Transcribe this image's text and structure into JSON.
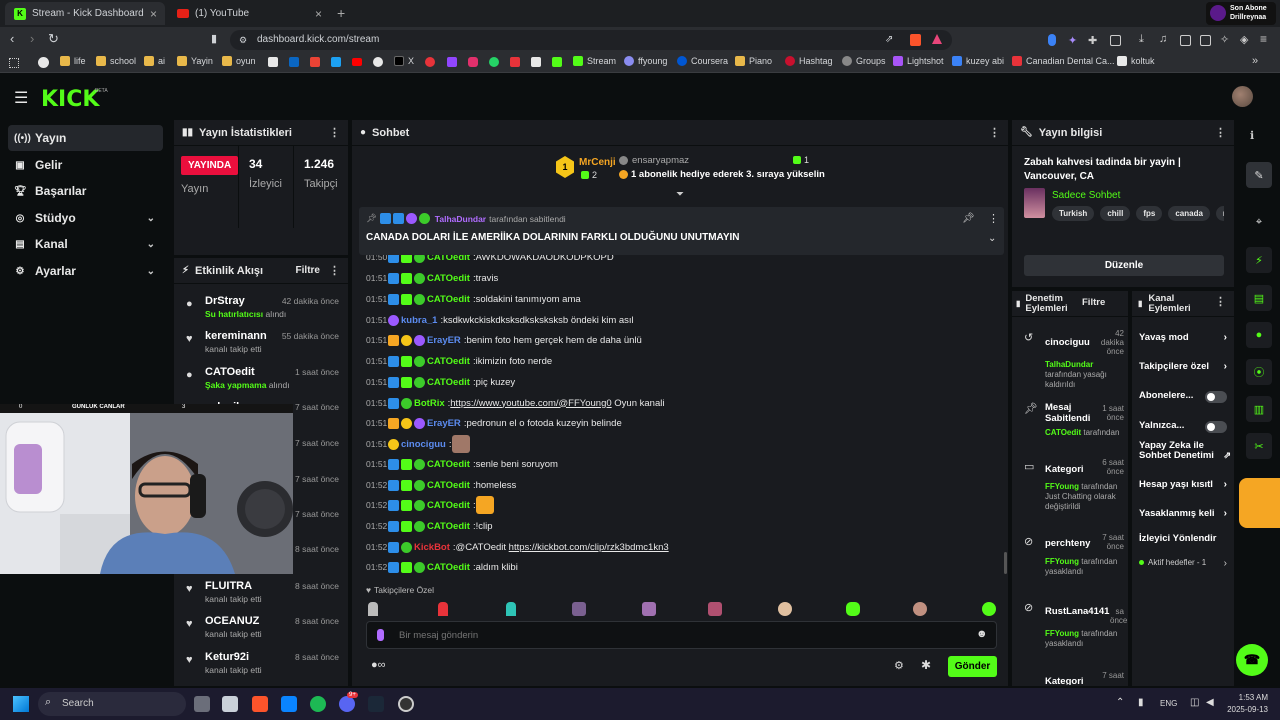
{
  "browser": {
    "tabs": [
      {
        "label": "Stream - Kick Dashboard",
        "active": true
      },
      {
        "label": "(1) YouTube",
        "active": false
      }
    ],
    "url": "dashboard.kick.com/stream",
    "notification": {
      "line1": "Son Abone",
      "line2": "Drillreynaa"
    },
    "bookmarks": [
      "life",
      "school",
      "ai",
      "Yayin",
      "oyun",
      "X",
      "Stream",
      "ffyoung",
      "Coursera",
      "Piano",
      "Hashtag",
      "Groups",
      "Lightshot",
      "kuzey abi",
      "Canadian Dental Ca...",
      "koltuk"
    ]
  },
  "kick": {
    "logo": "KICK",
    "logo_beta": "BETA"
  },
  "sidebar": {
    "items": [
      {
        "label": "Yayın",
        "icon": "broadcast-icon",
        "active": true
      },
      {
        "label": "Gelir",
        "icon": "revenue-icon"
      },
      {
        "label": "Başarılar",
        "icon": "trophy-icon"
      },
      {
        "label": "Stüdyo",
        "icon": "studio-icon",
        "expand": true
      },
      {
        "label": "Kanal",
        "icon": "channel-icon",
        "expand": true
      },
      {
        "label": "Ayarlar",
        "icon": "settings-icon",
        "expand": true
      }
    ]
  },
  "stats": {
    "title": "Yayın İstatistikleri",
    "live_label": "YAYINDA",
    "live_sub": "Yayın",
    "viewers": "34",
    "viewers_label": "İzleyici",
    "followers": "1.246",
    "followers_label": "Takipçi"
  },
  "feed": {
    "title": "Etkinlik Akışı",
    "filter": "Filtre",
    "items": [
      {
        "name": "DrStray",
        "sub_em": "Su hatırlatıcısı",
        "sub": " alındı",
        "time": "42 dakika önce",
        "icon": "user-group-icon"
      },
      {
        "name": "kereminann",
        "sub_em": "",
        "sub": "kanalı takip etti",
        "time": "55 dakika önce",
        "icon": "heart-icon"
      },
      {
        "name": "CATOedit",
        "sub_em": "Şaka yapmama",
        "sub": " alındı",
        "time": "1 saat önce",
        "icon": "user-group-icon"
      },
      {
        "name": "selanik",
        "sub_em": "",
        "sub": "",
        "time": "7 saat önce",
        "icon": "heart-icon"
      },
      {
        "name": "",
        "sub_em": "",
        "sub": "",
        "time": "7 saat önce",
        "icon": ""
      },
      {
        "name": "",
        "sub_em": "",
        "sub": "",
        "time": "7 saat önce",
        "icon": ""
      },
      {
        "name": "",
        "sub_em": "",
        "sub": "",
        "time": "7 saat önce",
        "icon": ""
      },
      {
        "name": "",
        "sub_em": "",
        "sub": "",
        "time": "8 saat önce",
        "icon": ""
      },
      {
        "name": "FLUITRA",
        "sub_em": "",
        "sub": "kanalı takip etti",
        "time": "8 saat önce",
        "icon": "heart-icon"
      },
      {
        "name": "OCEANUZ",
        "sub_em": "",
        "sub": "kanalı takip etti",
        "time": "8 saat önce",
        "icon": "heart-icon"
      },
      {
        "name": "Ketur92i",
        "sub_em": "",
        "sub": "kanalı takip etti",
        "time": "8 saat önce",
        "icon": "heart-icon"
      }
    ]
  },
  "webcam": {
    "overlay_left": "0",
    "overlay_title": "GÜNLÜK CANLAR",
    "overlay_right": "3"
  },
  "chat": {
    "title": "Sohbet",
    "top_gifter": {
      "name": "MrCenji",
      "count": "2",
      "rank": "1"
    },
    "gift_user": "ensaryapmaz",
    "gift_count": "1",
    "gift_text": "1 abonelik hediye ederek 3. sıraya yükselin",
    "pinned_by": "TalhaDundar",
    "pinned_by_suffix": "tarafından sabitlendi",
    "pinned_text": "CANADA DOLARI İLE AMERİİKA DOLARININ FARKLI OLDUĞUNU UNUTMAYIN",
    "messages": [
      {
        "time": "01:50",
        "user": "CATOedit",
        "color": "#53fc18",
        "badges": [
          "mod",
          "vip",
          "ver"
        ],
        "text": "AWKDOWAKDAODKODPKOPD",
        "link": ""
      },
      {
        "time": "01:51",
        "user": "CATOedit",
        "color": "#53fc18",
        "badges": [
          "mod",
          "vip",
          "ver"
        ],
        "text": "travis",
        "link": ""
      },
      {
        "time": "01:51",
        "user": "CATOedit",
        "color": "#53fc18",
        "badges": [
          "mod",
          "vip",
          "ver"
        ],
        "text": "soldakini tanımıyom ama",
        "link": ""
      },
      {
        "time": "01:51",
        "user": "kubra_1",
        "color": "#5c8cf0",
        "badges": [
          "sub"
        ],
        "text": "ksdkwkckiskdksksdksksksksb öndeki kim asıl",
        "link": ""
      },
      {
        "time": "01:51",
        "user": "ErayER",
        "color": "#5c8cf0",
        "badges": [
          "crown",
          "one",
          "sub"
        ],
        "text": "benim foto hem gerçek hem de daha ünlü",
        "link": ""
      },
      {
        "time": "01:51",
        "user": "CATOedit",
        "color": "#53fc18",
        "badges": [
          "mod",
          "vip",
          "ver"
        ],
        "text": "ikimizin foto nerde",
        "link": ""
      },
      {
        "time": "01:51",
        "user": "CATOedit",
        "color": "#53fc18",
        "badges": [
          "mod",
          "vip",
          "ver"
        ],
        "text": "piç kuzey",
        "link": ""
      },
      {
        "time": "01:51",
        "user": "BotRix",
        "color": "#53fc18",
        "badges": [
          "mod",
          "ver"
        ],
        "text": "",
        "link": "https://www.youtube.com/@FFYoung0",
        "after": " Oyun kanali"
      },
      {
        "time": "01:51",
        "user": "ErayER",
        "color": "#5c8cf0",
        "badges": [
          "crown",
          "one",
          "sub"
        ],
        "text": "pedronun el o fotoda kuzeyin belinde",
        "link": ""
      },
      {
        "time": "01:51",
        "user": "cinociguu",
        "color": "#5c8cf0",
        "badges": [
          "one"
        ],
        "text": "",
        "link": "",
        "emote": true
      },
      {
        "time": "01:51",
        "user": "CATOedit",
        "color": "#53fc18",
        "badges": [
          "mod",
          "vip",
          "ver"
        ],
        "text": "senle beni soruyom",
        "link": ""
      },
      {
        "time": "01:52",
        "user": "CATOedit",
        "color": "#53fc18",
        "badges": [
          "mod",
          "vip",
          "ver"
        ],
        "text": "homeless",
        "link": ""
      },
      {
        "time": "01:52",
        "user": "CATOedit",
        "color": "#53fc18",
        "badges": [
          "mod",
          "vip",
          "ver"
        ],
        "text": "",
        "link": "",
        "emote": true
      },
      {
        "time": "01:52",
        "user": "CATOedit",
        "color": "#53fc18",
        "badges": [
          "mod",
          "vip",
          "ver"
        ],
        "text": "!clip",
        "link": ""
      },
      {
        "time": "01:52",
        "user": "KickBot",
        "color": "#e8333a",
        "badges": [
          "mod",
          "ver"
        ],
        "text": "@CATOedit ",
        "link": "https://kickbot.com/clip/rzk3bdmc1kn3"
      },
      {
        "time": "01:52",
        "user": "CATOedit",
        "color": "#53fc18",
        "badges": [
          "mod",
          "vip",
          "ver"
        ],
        "text": "aldım klibi",
        "link": ""
      }
    ],
    "followers_only_label": "Takipçilere Özel",
    "input_placeholder": "Bir mesaj gönderin",
    "send_label": "Gönder"
  },
  "stream_info": {
    "title": "Yayın bilgisi",
    "stream_title": "Zabah kahvesi tadinda bir yayin | Vancouver, CA",
    "category": "Sadece Sohbet",
    "tags": [
      "Turkish",
      "chill",
      "fps",
      "canada",
      "maka"
    ],
    "edit_label": "Düzenle"
  },
  "mod_log": {
    "title": "Denetim Eylemleri",
    "filter": "Filtre",
    "items": [
      {
        "name": "cinociguu",
        "time": "42 dakika önce",
        "em": "TalhaDundar",
        "sub": " tarafından yasağı kaldırıldı",
        "icon": "unban-icon"
      },
      {
        "name": "Mesaj Sabitlendi",
        "time": "1 saat önce",
        "em": "CATOedit",
        "sub": " tarafından",
        "icon": "pin-icon"
      },
      {
        "name": "Kategori",
        "time": "6 saat önce",
        "em": "FFYoung",
        "sub": " tarafından Just Chatting olarak değiştirildi",
        "icon": "category-icon"
      },
      {
        "name": "perchteny",
        "time": "7 saat önce",
        "em": "FFYoung",
        "sub": " tarafından yasaklandı",
        "icon": "ban-icon"
      },
      {
        "name": "RustLana4141",
        "time": "sa önce",
        "em": "FFYoung",
        "sub": " tarafından yasaklandı",
        "icon": "ban-icon"
      },
      {
        "name": "Kategori",
        "time": "7 saat",
        "em": "",
        "sub": "",
        "icon": "category-icon"
      }
    ]
  },
  "channel_actions": {
    "title": "Kanal Eylemleri",
    "items": [
      {
        "label": "Yavaş mod",
        "control": "chevron"
      },
      {
        "label": "Takipçilere özel",
        "control": "chevron"
      },
      {
        "label": "Abonelere...",
        "control": "toggle"
      },
      {
        "label": "Yalnızca...",
        "control": "toggle"
      },
      {
        "label": "Yapay Zeka ile Sohbet Denetimi",
        "control": "external"
      },
      {
        "label": "Hesap yaşı kısıtl",
        "control": "chevron"
      },
      {
        "label": "Yasaklanmış keli",
        "control": "chevron"
      },
      {
        "label": "İzleyici Yönlendir",
        "control": ""
      },
      {
        "label": "Aktif hedefler - 1",
        "control": "chevron"
      }
    ]
  },
  "taskbar": {
    "search": "Search",
    "lang": "ENG",
    "time": "1:53 AM",
    "date": "2025-09-13",
    "discord_badge": "9+"
  },
  "colors": {
    "accent": "#53fc18",
    "live": "#ea0f3d",
    "panel": "#191b1f",
    "bg": "#0b0e0f"
  }
}
